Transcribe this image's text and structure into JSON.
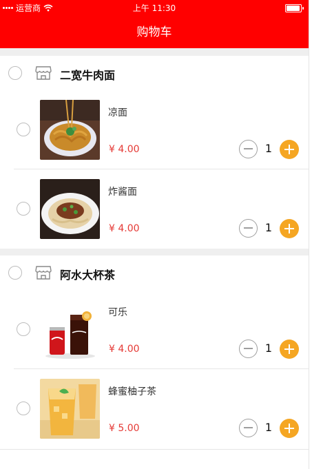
{
  "status_bar": {
    "carrier": "运营商",
    "time": "上午 11:30"
  },
  "nav": {
    "title": "购物车"
  },
  "shops": [
    {
      "name": "二宽牛肉面",
      "items": [
        {
          "name": "凉面",
          "price": "¥ 4.00",
          "qty": "1",
          "image": "cold-noodles"
        },
        {
          "name": "炸酱面",
          "price": "¥ 4.00",
          "qty": "1",
          "image": "zhajiang-noodles"
        }
      ]
    },
    {
      "name": "阿水大杯茶",
      "items": [
        {
          "name": "可乐",
          "price": "¥ 4.00",
          "qty": "1",
          "image": "cola"
        },
        {
          "name": "蜂蜜柚子茶",
          "price": "¥ 5.00",
          "qty": "1",
          "image": "honey-citron-tea"
        }
      ]
    }
  ],
  "colors": {
    "brand": "#ff0000",
    "price": "#e53935",
    "plus": "#f5a623"
  }
}
